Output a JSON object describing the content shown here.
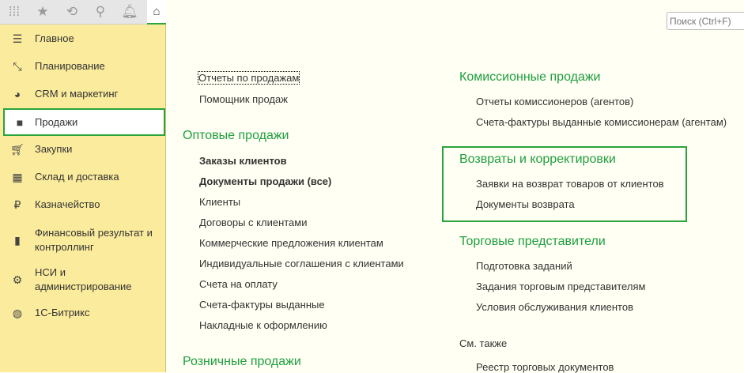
{
  "toolbar": {
    "icons": [
      "apps-grid-icon",
      "star-icon",
      "history-icon",
      "search-icon",
      "bell-icon",
      "home-icon"
    ]
  },
  "search": {
    "placeholder": "Поиск (Ctrl+F)"
  },
  "sidebar": {
    "items": [
      {
        "label": "Главное",
        "icon": "menu-icon"
      },
      {
        "label": "Планирование",
        "icon": "planning-icon"
      },
      {
        "label": "CRM и маркетинг",
        "icon": "pie-chart-icon"
      },
      {
        "label": "Продажи",
        "icon": "bag-icon",
        "selected": true
      },
      {
        "label": "Закупки",
        "icon": "cart-icon"
      },
      {
        "label": "Склад и доставка",
        "icon": "warehouse-icon"
      },
      {
        "label": "Казначейство",
        "icon": "ruble-icon"
      },
      {
        "label": "Финансовый результат и контроллинг",
        "icon": "bar-chart-icon"
      },
      {
        "label": "НСИ и администрирование",
        "icon": "gear-icon"
      },
      {
        "label": "1С-Битрикс",
        "icon": "bitrix-icon"
      }
    ]
  },
  "main": {
    "top_links": [
      "Отчеты по продажам",
      "Помощник продаж"
    ],
    "wholesale": {
      "title": "Оптовые продажи",
      "items": [
        "Заказы клиентов",
        "Документы продажи (все)",
        "Клиенты",
        "Договоры с клиентами",
        "Коммерческие предложения клиентам",
        "Индивидуальные соглашения с клиентами",
        "Счета на оплату",
        "Счета-фактуры выданные",
        "Накладные к оформлению"
      ]
    },
    "retail": {
      "title": "Розничные продажи"
    },
    "commission": {
      "title": "Комиссионные продажи",
      "items": [
        "Отчеты комиссионеров (агентов)",
        "Счета-фактуры выданные комиссионерам (агентам)"
      ]
    },
    "returns": {
      "title": "Возвраты и корректировки",
      "items": [
        "Заявки на возврат товаров от клиентов",
        "Документы возврата"
      ]
    },
    "reps": {
      "title": "Торговые представители",
      "items": [
        "Подготовка заданий",
        "Задания торговым представителям",
        "Условия обслуживания клиентов"
      ]
    },
    "see_also": {
      "title": "См. также",
      "items": [
        "Реестр торговых документов"
      ]
    }
  }
}
